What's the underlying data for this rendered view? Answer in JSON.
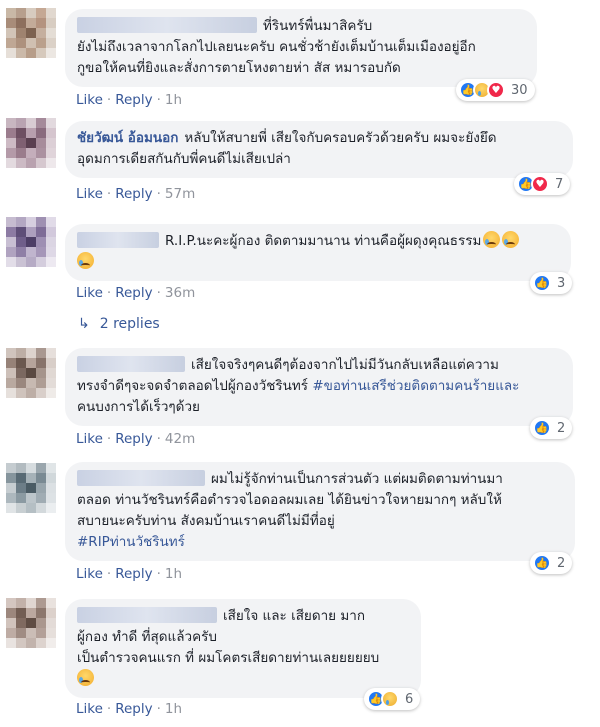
{
  "actions": {
    "like": "Like",
    "reply": "Reply",
    "dot": "·"
  },
  "replies_link": {
    "label": "2 replies"
  },
  "comments": [
    {
      "lines": [
        "ที่รินทร์พื่นมาสิครับ",
        "ยังไม่ถึงเวลาจากโลกไปเลยนะครับ คนชั่วช้ายังเต็มบ้านเต็มเมืองอยู่อีก",
        "กูขอให้คนที่ยิงและสั่งการตายโหงตายห่า สัส หมารอบกัด"
      ],
      "time": "1h",
      "reaction_count": "30",
      "reaction_icons": [
        "like-icon",
        "sad-icon",
        "love-icon"
      ]
    },
    {
      "author": "ชัยวัฒน์ อ้อมนอก",
      "lines": [
        "หลับให้สบายพี่ เสียใจกับครอบครัวด้วยครับ ผมจะยังยึด",
        "อุดมการเดียสกันกับพี่คนดีไม่เสียเปล่า"
      ],
      "time": "57m",
      "reaction_count": "7",
      "reaction_icons": [
        "like-icon",
        "love-icon"
      ]
    },
    {
      "lines": [
        "R.I.P.นะคะผู้กอง ติดตามมานาน ท่านคือผู้ผดุงคุณธรรม"
      ],
      "time": "36m",
      "reaction_count": "3",
      "reaction_icons": [
        "like-icon"
      ]
    },
    {
      "lines": [
        "เสียใจจริงๆคนดีๆต้องจากไปไม่มีวันกลับเหลือแต่ความ",
        "ทรงจำดีๆจะจดจำตลอดไปผู้กองวัชรินทร์",
        "คนบงการได้เร็วๆด้วย"
      ],
      "hashtag": "#ขอท่านเสรีช่วยติดตามคนร้ายและ",
      "time": "42m",
      "reaction_count": "2",
      "reaction_icons": [
        "like-icon"
      ]
    },
    {
      "lines": [
        "ผมไม่รู้จักท่านเป็นการส่วนตัว แต่ผมติดตามท่านมา",
        "ตลอด ท่านวัชรินทร์คือตำรวจไอดอลผมเลย ได้ยินข่าวใจหายมากๆ หลับให้",
        "สบายนะครับท่าน สังคมบ้านเราคนดีไม่มีที่อยู่"
      ],
      "hashtag": "#RIPท่านวัชรินทร์",
      "time": "1h",
      "reaction_count": "2",
      "reaction_icons": [
        "like-icon"
      ]
    },
    {
      "lines": [
        "เสียใจ และ เสียดาย มาก",
        "ผู้กอง ทำดี ที่สุดแล้วครับ",
        "เป็นตำรวจคนแรก ที่ ผมโคตรเสียดายท่านเลยยยยยบ"
      ],
      "time": "1h",
      "reaction_count": "6",
      "reaction_icons": [
        "like-icon",
        "sad-icon"
      ]
    }
  ],
  "colors": {
    "link": "#385898",
    "bubble": "#f2f3f5",
    "meta": "#90949c",
    "like": "#2078f4",
    "love": "#f0284a"
  }
}
